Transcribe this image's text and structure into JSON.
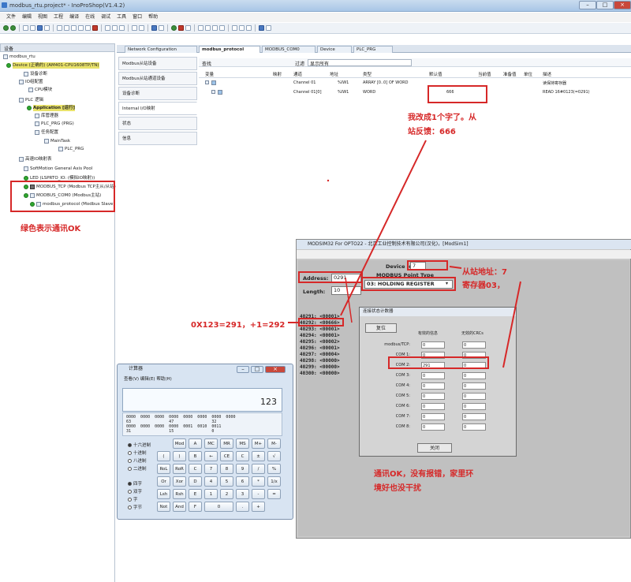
{
  "window": {
    "title": "modbus_rtu.project* - InoProShop(V1.4.2)"
  },
  "menu": [
    "文件",
    "编辑",
    "视图",
    "工程",
    "编译",
    "在线",
    "调试",
    "工具",
    "窗口",
    "帮助"
  ],
  "left_panel": {
    "title": "设备",
    "items": [
      "modbus_rtu",
      "Device (正确的) (AM401-CPU1608TP/TN)",
      "设备诊断",
      "IO组配置",
      "CPU模块",
      "PLC 逻辑",
      "Application [运行]",
      "库管理器",
      "PLC_PRG (PRG)",
      "任务配置",
      "MainTask",
      "PLC_PRG",
      "高速IO映射表",
      "SoftMotion General Axis Pool",
      "LED (LSPRTO_IO: (模拟IO映射))",
      "MODBUS_TCP (Modbus TCP主从/从站)",
      "MODBUS_COM0 (Modbus主站)",
      "modbus_protocol (Modbus Slave)"
    ]
  },
  "tabs": [
    "Network Configuration",
    "modbus_protocol",
    "MODBUS_COM0",
    "Device",
    "PLC_PRG"
  ],
  "side_tabs": [
    "Modbus从站设备",
    "Modbus从站通道设备",
    "设备诊断",
    "Internal I/O映射",
    "状态",
    "信息"
  ],
  "filter": {
    "find_label": "查找",
    "filter_label": "过滤",
    "filter_value": "显示所有"
  },
  "grid": {
    "headers": [
      "变量",
      "映射",
      "通道",
      "地址",
      "类型",
      "默认值",
      "当前值",
      "准备值",
      "单位",
      "描述"
    ],
    "rows": [
      {
        "var": "",
        "channel": "Channel 01",
        "addr": "%IW1",
        "type": "ARRAY [0..0] OF WORD",
        "default": "",
        "desc": "读保持寄存器"
      },
      {
        "var": "",
        "channel": "Channel 01[0]",
        "addr": "%IW1",
        "type": "WORD",
        "default": "666",
        "desc": "READ 16#0123(=0291)"
      }
    ]
  },
  "annotations": {
    "changed": "我改成1个字了。从",
    "changed2": "站反馈：666",
    "green": "绿色表示通讯OK",
    "slave_addr": "从站地址：7",
    "register": "寄存器03，",
    "hex": "0X123=291，+1=292",
    "ok1": "通讯OK，没有报错，家里环",
    "ok2": "境好也没干扰"
  },
  "modsim": {
    "title": "MODSIM32 For OPTO22 - 北京工业控制技术有限公司(汉化)，[ModSim1]",
    "device_id_label": "Device Id:",
    "device_id": "7",
    "modbus_point_label": "MODBUS Point Type",
    "address_label": "Address:",
    "address": "0291",
    "length_label": "Length:",
    "length": "10",
    "point_type": "03: HOLDING REGISTER",
    "registers": [
      "40291: <00001>",
      "40292: <00666>",
      "40293: <00001>",
      "40294: <00001>",
      "40295: <00002>",
      "40296: <00001>",
      "40297: <00004>",
      "40298: <00000>",
      "40299: <00000>",
      "40300: <00000>"
    ]
  },
  "comm_dialog": {
    "title": "连接状态计数器",
    "reset": "复位",
    "col1": "有效的信息",
    "col2": "无效的CRCs",
    "ports": [
      "modbus/TCP:",
      "COM 1:",
      "COM 2:",
      "COM 3:",
      "COM 4:",
      "COM 5:",
      "COM 6:",
      "COM 7:",
      "COM 8:"
    ],
    "valid": [
      "0",
      "0",
      "291",
      "0",
      "0",
      "0",
      "0",
      "0",
      "0"
    ],
    "invalid": [
      "0",
      "0",
      "0",
      "0",
      "0",
      "0",
      "0",
      "0",
      "0"
    ],
    "close": "关闭"
  },
  "calculator": {
    "title": "计算器",
    "menu": "查看(V)   编辑(E)   帮助(H)",
    "display": "123",
    "bits": "0000  0000  0000  0000  0000  0000  0000  0000\n63                47                32\n0000  0000  0000  0000  0001  0010  0011\n31                15                0",
    "radix": [
      "十六进制",
      "十进制",
      "八进制",
      "二进制"
    ],
    "word": [
      "四字",
      "双字",
      "字",
      "字节"
    ],
    "keys": [
      [
        "",
        "Mod",
        "A",
        "MC",
        "MR",
        "MS",
        "M+",
        "M-"
      ],
      [
        "(",
        ")",
        "B",
        "←",
        "CE",
        "C",
        "±",
        "√"
      ],
      [
        "RoL",
        "RoR",
        "C",
        "7",
        "8",
        "9",
        "/",
        "%"
      ],
      [
        "Or",
        "Xor",
        "D",
        "4",
        "5",
        "6",
        "*",
        "1/x"
      ],
      [
        "Lsh",
        "Rsh",
        "E",
        "1",
        "2",
        "3",
        "-",
        "="
      ],
      [
        "Not",
        "And",
        "F",
        "0",
        "",
        ".",
        "+",
        ""
      ]
    ]
  }
}
